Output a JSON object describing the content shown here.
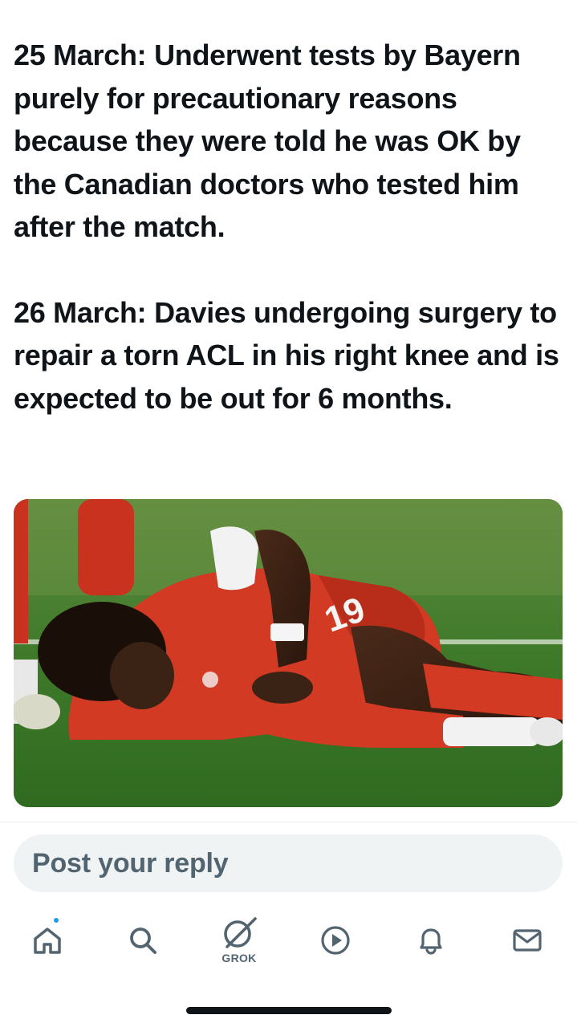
{
  "post": {
    "paragraphs": [
      "25 March: Underwent tests by Bayern purely for precautionary reasons because they were told he was OK by the Canadian doctors who tested him after the match.",
      "26 March: Davies undergoing surgery to repair a torn ACL in his right knee and is expected to be out for 6 months."
    ]
  },
  "reply": {
    "placeholder": "Post your reply"
  },
  "nav": {
    "items": [
      {
        "name": "home",
        "icon": "home-icon",
        "has_badge": true
      },
      {
        "name": "search",
        "icon": "search-icon"
      },
      {
        "name": "grok",
        "icon": "grok-icon",
        "label": "GROK"
      },
      {
        "name": "videos",
        "icon": "play-icon"
      },
      {
        "name": "notifications",
        "icon": "bell-icon"
      },
      {
        "name": "messages",
        "icon": "mail-icon"
      }
    ]
  },
  "colors": {
    "text": "#0f1419",
    "muted": "#536471",
    "reply_bg": "#eff3f4",
    "accent": "#1d9bf0"
  }
}
